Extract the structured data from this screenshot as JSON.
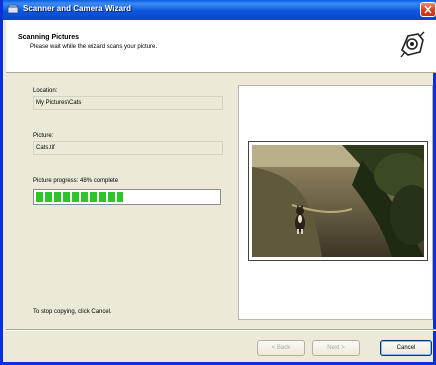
{
  "window": {
    "title": "Scanner and Camera Wizard"
  },
  "header": {
    "title": "Scanning Pictures",
    "subtitle": "Please wait while the wizard scans your picture."
  },
  "fields": {
    "location_label": "Location:",
    "location_value": "My Pictures\\Cats",
    "picture_label": "Picture:",
    "picture_value": "Cats.tif",
    "progress_label": "Picture progress: 48% complete",
    "progress_fraction": 0.48
  },
  "stop_hint": "To stop copying, click Cancel.",
  "buttons": {
    "back": "< Back",
    "next": "Next >",
    "cancel": "Cancel"
  },
  "colors": {
    "titlebar": "#0a56de",
    "progress": "#2cc62c",
    "dialog": "#ece9d8"
  },
  "icons": [
    "scanner-wizard-icon",
    "close-icon",
    "camera-icon"
  ]
}
